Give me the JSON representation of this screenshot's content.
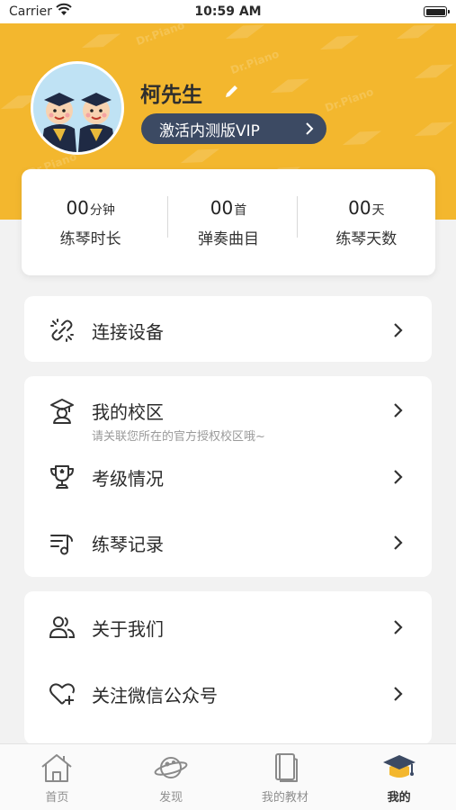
{
  "status_bar": {
    "carrier": "Carrier",
    "time": "10:59 AM"
  },
  "profile": {
    "name": "柯先生",
    "vip_label": "激活内测版VIP",
    "watermark": "Dr.Piano"
  },
  "stats": [
    {
      "value": "00",
      "unit": "分钟",
      "label": "练琴时长"
    },
    {
      "value": "00",
      "unit": "首",
      "label": "弹奏曲目"
    },
    {
      "value": "00",
      "unit": "天",
      "label": "练琴天数"
    }
  ],
  "menu": {
    "connect": {
      "label": "连接设备",
      "icon": "link-icon"
    },
    "campus": {
      "label": "我的校区",
      "hint": "请关联您所在的官方授权校区哦~",
      "icon": "campus-icon"
    },
    "exam": {
      "label": "考级情况",
      "icon": "trophy-icon"
    },
    "record": {
      "label": "练琴记录",
      "icon": "music-list-icon"
    },
    "about": {
      "label": "关于我们",
      "icon": "users-icon"
    },
    "wechat": {
      "label": "关注微信公众号",
      "icon": "heart-plus-icon"
    }
  },
  "tabs": [
    {
      "label": "首页",
      "icon": "home-icon"
    },
    {
      "label": "发现",
      "icon": "planet-icon"
    },
    {
      "label": "我的教材",
      "icon": "book-icon"
    },
    {
      "label": "我的",
      "icon": "graduation-cap-icon",
      "active": true
    }
  ],
  "colors": {
    "accent": "#f3b72e",
    "vip_bg": "#3c4a63",
    "background": "#f2f2f2"
  }
}
